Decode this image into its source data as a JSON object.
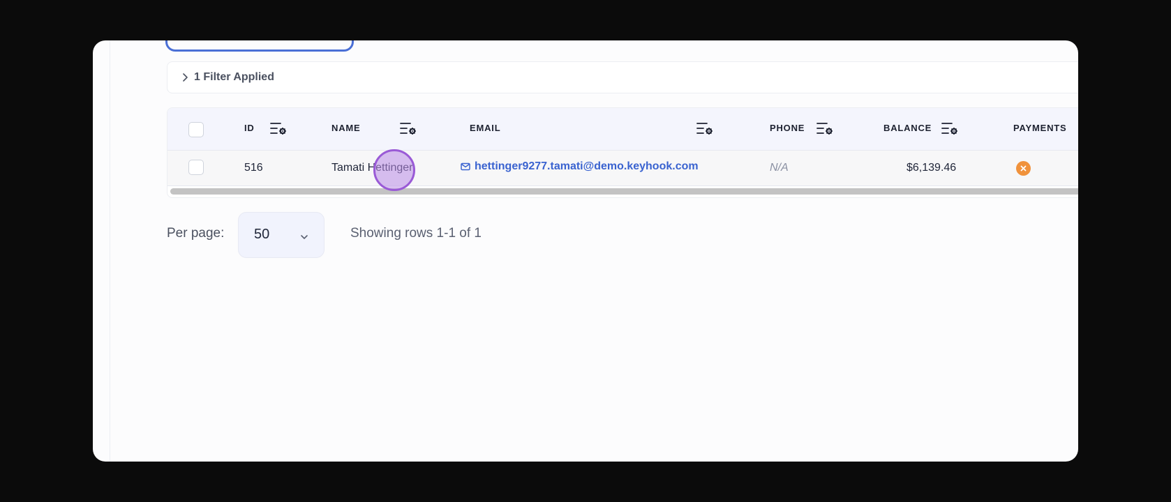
{
  "filter": {
    "label": "1 Filter Applied"
  },
  "table": {
    "columns": [
      {
        "key": "id",
        "label": "ID"
      },
      {
        "key": "name",
        "label": "NAME"
      },
      {
        "key": "email",
        "label": "EMAIL"
      },
      {
        "key": "phone",
        "label": "PHONE"
      },
      {
        "key": "balance",
        "label": "BALANCE"
      },
      {
        "key": "payments",
        "label": "PAYMENTS"
      }
    ],
    "rows": [
      {
        "id": "516",
        "name": "Tamati Hettinger",
        "email": "hettinger9277.tamati@demo.keyhook.com",
        "phone": "N/A",
        "balance": "$6,139.46",
        "payments_icon": "x-circle-icon"
      }
    ]
  },
  "pagination": {
    "per_page_label": "Per page:",
    "per_page_value": "50",
    "rows_info": "Showing rows 1-1 of 1"
  },
  "colors": {
    "accent": "#3a63d0",
    "payments_badge": "#f0923c",
    "cursor": "#9a5ad6"
  }
}
